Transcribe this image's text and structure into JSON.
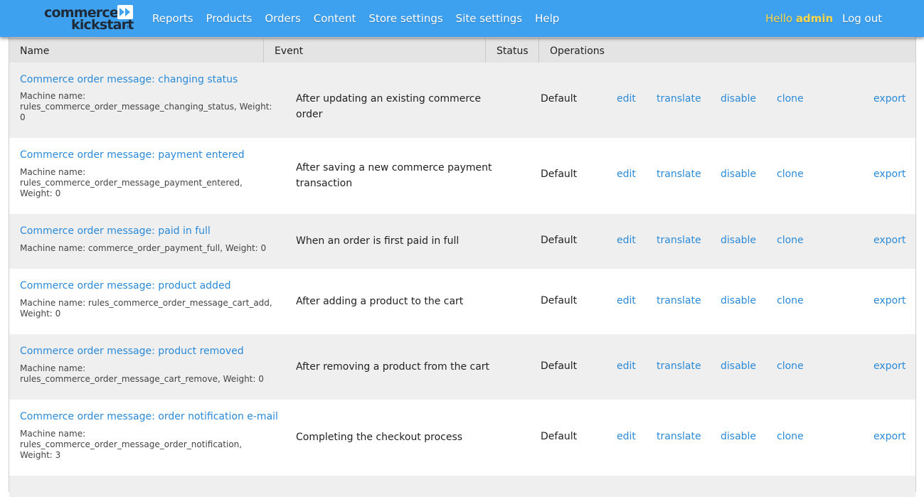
{
  "brand": {
    "line1": "commerce",
    "line2": "kickstart",
    "tm": "TM"
  },
  "nav": {
    "items": [
      "Reports",
      "Products",
      "Orders",
      "Content",
      "Store settings",
      "Site settings",
      "Help"
    ]
  },
  "user": {
    "greeting": "Hello",
    "username": "admin",
    "logout": "Log out"
  },
  "table": {
    "headers": {
      "name": "Name",
      "event": "Event",
      "status": "Status",
      "operations": "Operations"
    },
    "operations": {
      "edit": "edit",
      "translate": "translate",
      "disable": "disable",
      "clone": "clone",
      "export": "export"
    },
    "rows": [
      {
        "title": "Commerce order message: changing status",
        "meta": "Machine name: rules_commerce_order_message_changing_status, Weight: 0",
        "event": "After updating an existing commerce order",
        "status": "Default"
      },
      {
        "title": "Commerce order message: payment entered",
        "meta": "Machine name: rules_commerce_order_message_payment_entered, Weight: 0",
        "event": "After saving a new commerce payment transaction",
        "status": "Default"
      },
      {
        "title": "Commerce order message: paid in full",
        "meta": "Machine name: commerce_order_payment_full, Weight: 0",
        "event": "When an order is first paid in full",
        "status": "Default"
      },
      {
        "title": "Commerce order message: product added",
        "meta": "Machine name: rules_commerce_order_message_cart_add, Weight: 0",
        "event": "After adding a product to the cart",
        "status": "Default"
      },
      {
        "title": "Commerce order message: product removed",
        "meta": "Machine name: rules_commerce_order_message_cart_remove, Weight: 0",
        "event": "After removing a product from the cart",
        "status": "Default"
      },
      {
        "title": "Commerce order message: order notification e-mail",
        "meta": "Machine name: rules_commerce_order_message_order_notification, Weight: 3",
        "event": "Completing the checkout process",
        "status": "Default"
      }
    ]
  }
}
